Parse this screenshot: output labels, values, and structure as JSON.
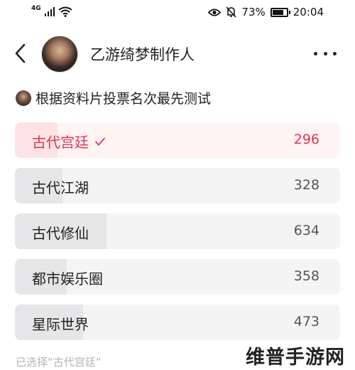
{
  "status_bar": {
    "network": "4G",
    "battery_percent": "73%",
    "time": "20:04",
    "icons": [
      "signal-icon",
      "wifi-icon",
      "eye-icon",
      "mute-icon",
      "battery-icon"
    ]
  },
  "header": {
    "back_icon": "back-chevron-icon",
    "author_name": "乙游绮梦制作人",
    "more_icon": "more-dots-icon"
  },
  "poll": {
    "title": "根据资料片投票名次最先测试",
    "options": [
      {
        "label": "古代宫廷",
        "count": "296",
        "selected": true,
        "share": 0.1317
      },
      {
        "label": "古代江湖",
        "count": "328",
        "selected": false,
        "share": 0.1459
      },
      {
        "label": "古代修仙",
        "count": "634",
        "selected": false,
        "share": 0.282
      },
      {
        "label": "都市娱乐圈",
        "count": "358",
        "selected": false,
        "share": 0.1592
      },
      {
        "label": "星际世界",
        "count": "473",
        "selected": false,
        "share": 0.2104
      }
    ],
    "selected_note": "已选择“古代宫廷”"
  },
  "watermark": {
    "text": "维普手游网"
  },
  "colors": {
    "accent": "#e0374f",
    "selected_bg": "#fff3f4",
    "option_bg": "#f4f4f5"
  }
}
